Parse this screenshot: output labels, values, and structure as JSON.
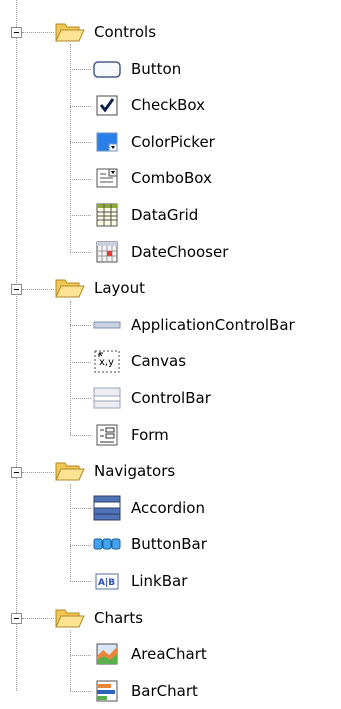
{
  "tree": {
    "groups": [
      {
        "label": "Controls",
        "icon": "folder-open-icon",
        "expanded": true,
        "items": [
          {
            "label": "Button",
            "icon": "button-icon"
          },
          {
            "label": "CheckBox",
            "icon": "checkbox-icon"
          },
          {
            "label": "ColorPicker",
            "icon": "colorpicker-icon"
          },
          {
            "label": "ComboBox",
            "icon": "combobox-icon"
          },
          {
            "label": "DataGrid",
            "icon": "datagrid-icon"
          },
          {
            "label": "DateChooser",
            "icon": "datechooser-icon"
          }
        ]
      },
      {
        "label": "Layout",
        "icon": "folder-open-icon",
        "expanded": true,
        "items": [
          {
            "label": "ApplicationControlBar",
            "icon": "applicationcontrolbar-icon"
          },
          {
            "label": "Canvas",
            "icon": "canvas-icon"
          },
          {
            "label": "ControlBar",
            "icon": "controlbar-icon"
          },
          {
            "label": "Form",
            "icon": "form-icon"
          }
        ]
      },
      {
        "label": "Navigators",
        "icon": "folder-open-icon",
        "expanded": true,
        "items": [
          {
            "label": "Accordion",
            "icon": "accordion-icon"
          },
          {
            "label": "ButtonBar",
            "icon": "buttonbar-icon"
          },
          {
            "label": "LinkBar",
            "icon": "linkbar-icon"
          }
        ]
      },
      {
        "label": "Charts",
        "icon": "folder-open-icon",
        "expanded": true,
        "items": [
          {
            "label": "AreaChart",
            "icon": "areachart-icon"
          },
          {
            "label": "BarChart",
            "icon": "barchart-icon"
          }
        ]
      }
    ]
  }
}
